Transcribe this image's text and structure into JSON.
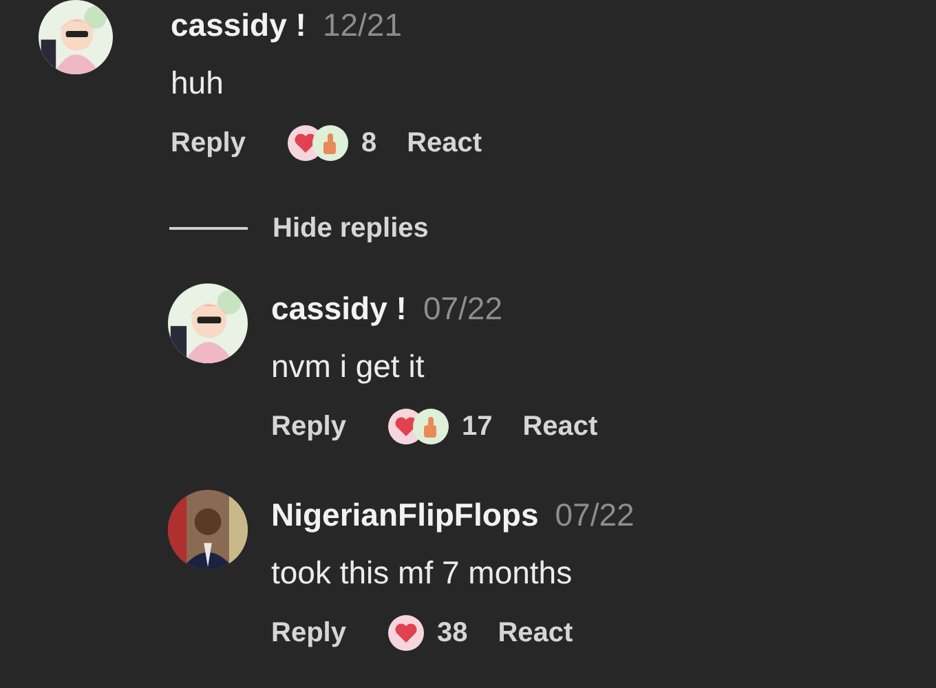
{
  "comments": [
    {
      "author": "cassidy !",
      "date": "12/21",
      "text": "huh",
      "reply_label": "Reply",
      "reactions": [
        {
          "kind": "heart"
        },
        {
          "kind": "thumbs"
        }
      ],
      "reaction_count": "8",
      "react_label": "React",
      "hide_replies": "Hide replies",
      "replies": [
        {
          "author": "cassidy !",
          "date": "07/22",
          "text": "nvm i get it",
          "reply_label": "Reply",
          "reactions": [
            {
              "kind": "heart"
            },
            {
              "kind": "thumbs"
            }
          ],
          "reaction_count": "17",
          "react_label": "React"
        },
        {
          "author": "NigerianFlipFlops",
          "date": "07/22",
          "text": "took this mf 7 months",
          "reply_label": "Reply",
          "reactions": [
            {
              "kind": "heart"
            }
          ],
          "reaction_count": "38",
          "react_label": "React"
        }
      ]
    }
  ]
}
